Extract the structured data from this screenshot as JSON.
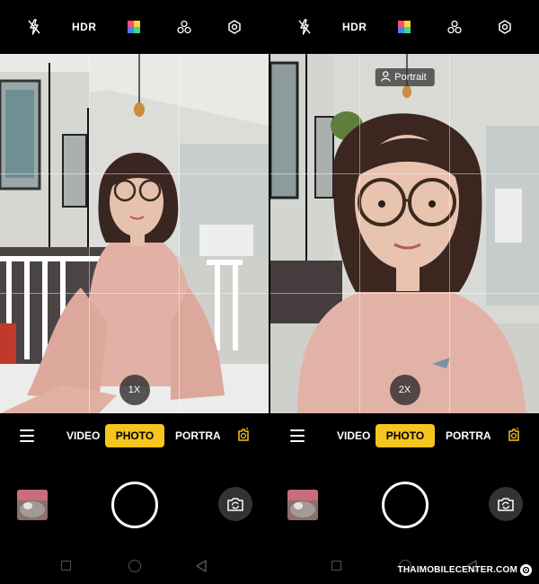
{
  "screens": [
    {
      "topbar": {
        "flash_icon": "flash-off-icon",
        "hdr_label": "HDR",
        "filter_icon": "color-filter-icon",
        "beauty_icon": "beauty-icon",
        "settings_icon": "settings-icon"
      },
      "viewfinder": {
        "zoom_label": "1X"
      },
      "modes": {
        "video": "VIDEO",
        "photo": "PHOTO",
        "portrait": "PORTRAIT",
        "selected": "PHOTO"
      }
    },
    {
      "topbar": {
        "flash_icon": "flash-off-icon",
        "hdr_label": "HDR",
        "filter_icon": "color-filter-icon",
        "beauty_icon": "beauty-icon",
        "settings_icon": "settings-icon"
      },
      "viewfinder": {
        "zoom_label": "2X",
        "portrait_tag": "Portrait"
      },
      "modes": {
        "video": "VIDEO",
        "photo": "PHOTO",
        "portrait": "PORTRAIT",
        "selected": "PHOTO"
      }
    }
  ],
  "watermark": {
    "text": "THAIMOBILECENTER.COM"
  },
  "colors": {
    "accent": "#f7c41d",
    "background": "#000000"
  }
}
